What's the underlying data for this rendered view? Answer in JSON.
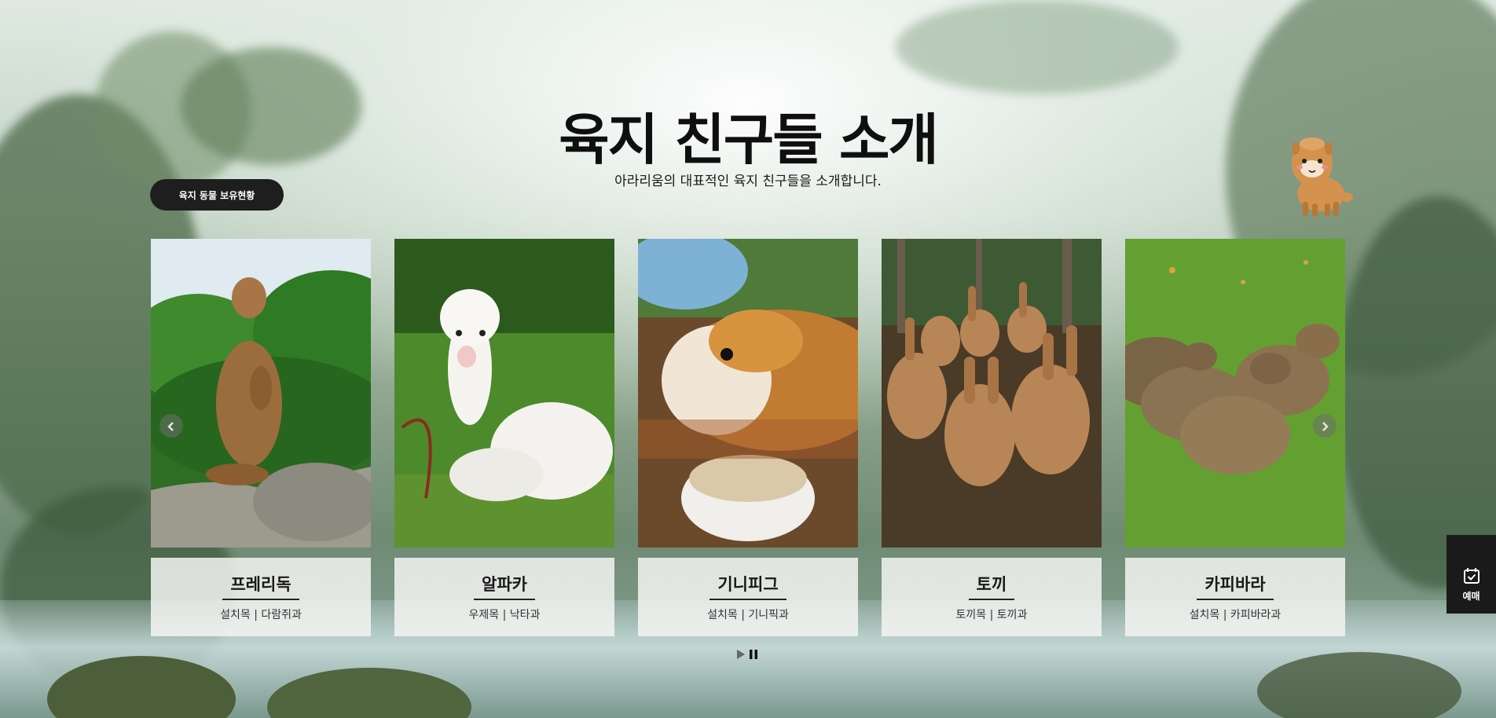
{
  "header": {
    "title": "육지 친구들 소개",
    "subtitle": "아라리움의 대표적인 육지 친구들을 소개합니다."
  },
  "stock_button": {
    "label": "육지 동물 보유현황"
  },
  "cards": [
    {
      "name": "프레리독",
      "taxon": "설치목 | 다람쥐과"
    },
    {
      "name": "알파카",
      "taxon": "우제목 | 낙타과"
    },
    {
      "name": "기니피그",
      "taxon": "설치목 | 기니픽과"
    },
    {
      "name": "토끼",
      "taxon": "토끼목 | 토끼과"
    },
    {
      "name": "카피바라",
      "taxon": "설치목 | 카피바라과"
    }
  ],
  "slider": {
    "prev_icon": "chevron-left-icon",
    "next_icon": "chevron-right-icon",
    "play_icon": "play-icon",
    "pause_icon": "pause-icon"
  },
  "side": {
    "reserve_label": "예매",
    "reserve_icon": "calendar-check-icon"
  },
  "colors": {
    "dark": "#1e1e1e",
    "card_bg": "#f4f4f2"
  }
}
